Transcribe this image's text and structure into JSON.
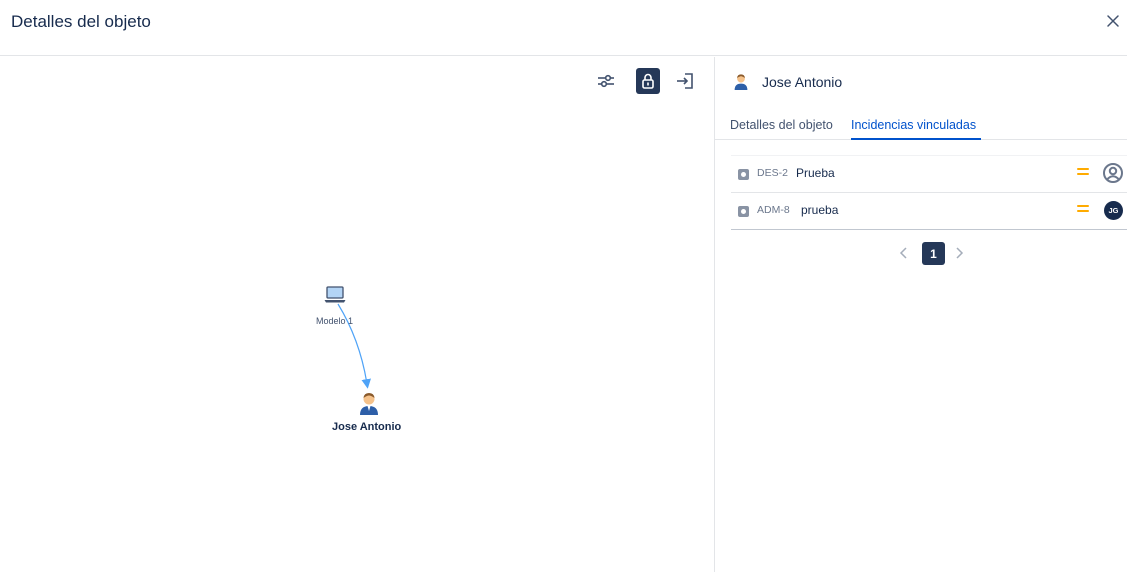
{
  "dialog": {
    "title": "Detalles del objeto",
    "close_icon": "close-icon"
  },
  "toolbar": {
    "items": [
      {
        "icon": "sliders-icon",
        "active": false
      },
      {
        "icon": "lock-icon",
        "active": true
      },
      {
        "icon": "collapse-panel-icon",
        "active": false
      }
    ]
  },
  "graph": {
    "nodes": [
      {
        "label": "Modelo 1",
        "icon": "laptop-icon"
      },
      {
        "label": "Jose Antonio",
        "icon": "person-icon"
      }
    ],
    "edge": {
      "from": "Modelo 1",
      "to": "Jose Antonio",
      "color": "#4fa3f7"
    }
  },
  "panel": {
    "title": "Jose Antonio",
    "icon": "person-icon",
    "tabs": [
      {
        "label": "Detalles del objeto",
        "active": false
      },
      {
        "label": "Incidencias vinculadas",
        "active": true
      }
    ],
    "issues": [
      {
        "key": "DES-2",
        "summary": "Prueba",
        "priority": "medium",
        "assignee": "",
        "avatar": "default-avatar-icon"
      },
      {
        "key": "ADM-8",
        "summary": "prueba",
        "priority": "medium",
        "assignee": "JG",
        "avatar": "initials"
      }
    ],
    "pagination": {
      "current_page": "1"
    }
  },
  "colors": {
    "text": "#172b4d",
    "accent_blue": "#0052cc",
    "dark_navy": "#253858",
    "priority_medium": "#ffab00",
    "edge": "#4fa3f7"
  }
}
